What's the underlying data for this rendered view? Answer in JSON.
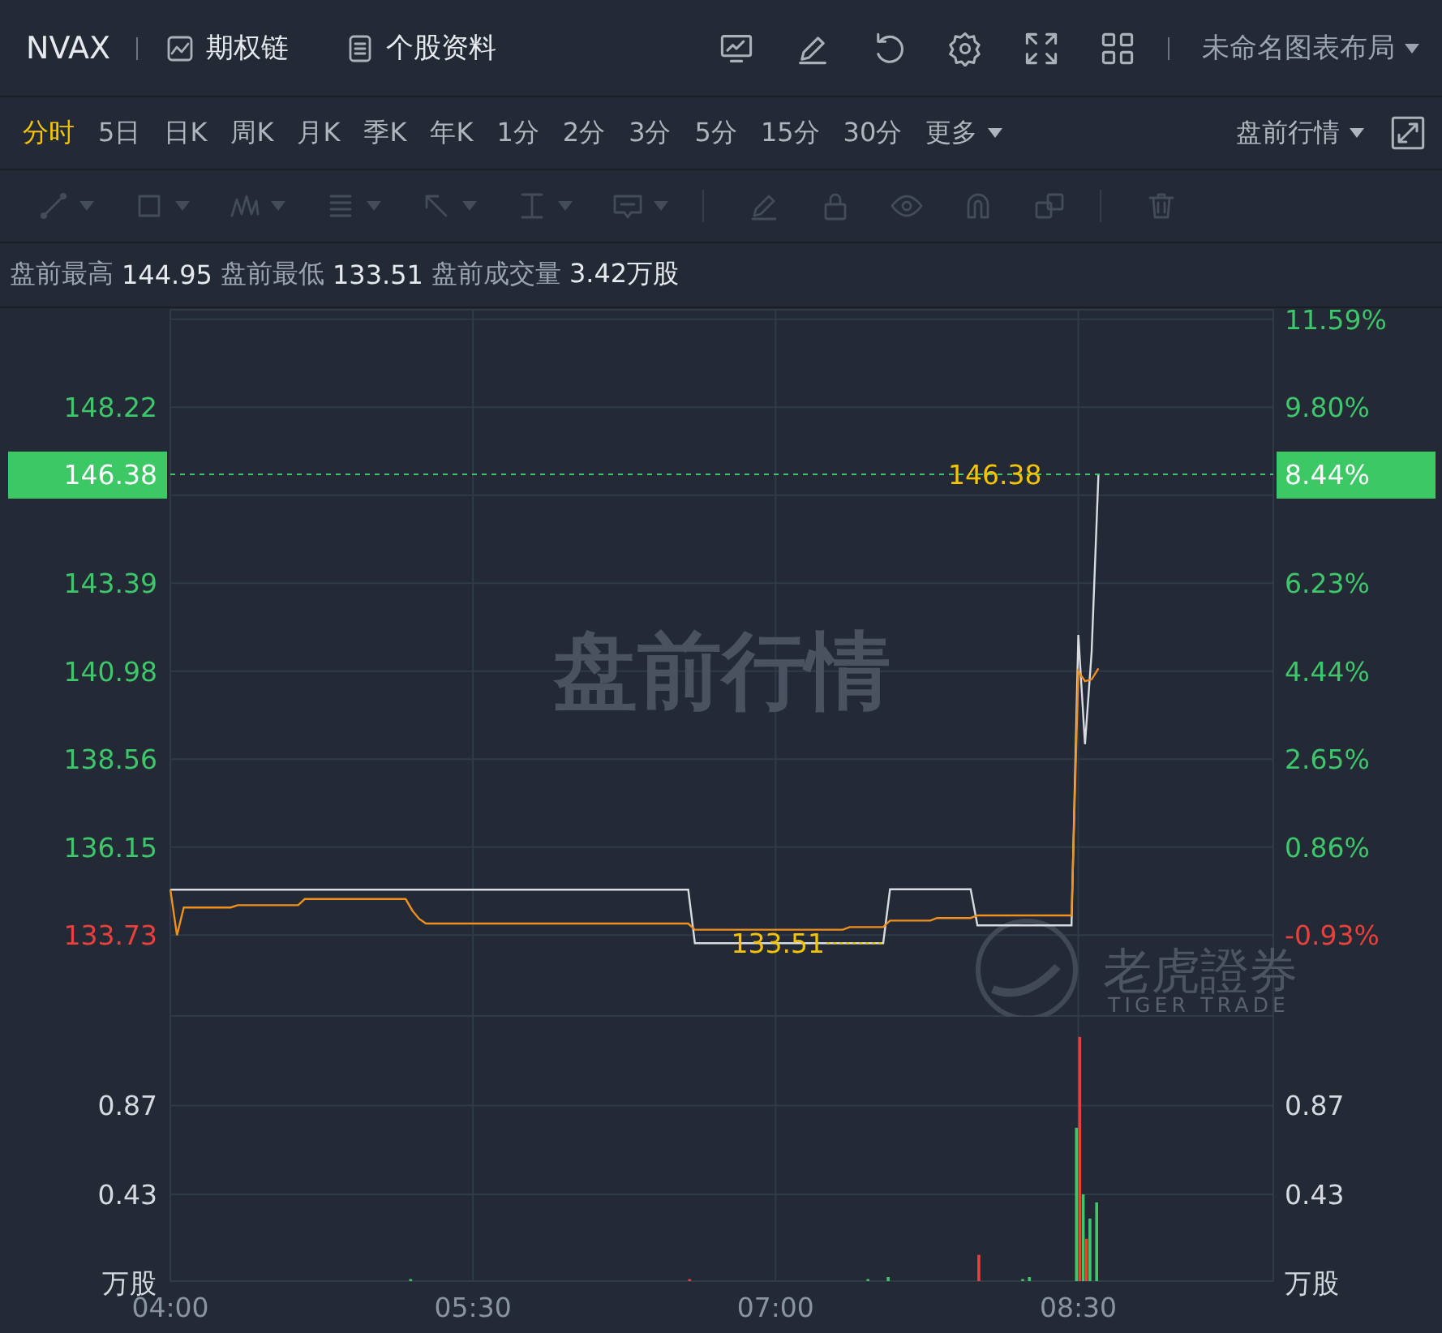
{
  "header": {
    "symbol": "NVAX",
    "links": [
      {
        "kind": "chain",
        "label": "期权链"
      },
      {
        "kind": "profile",
        "label": "个股资料"
      }
    ],
    "layout_menu": "未命名图表布局"
  },
  "periods": [
    {
      "label": "分时",
      "selected": true
    },
    {
      "label": "5日",
      "selected": false
    },
    {
      "label": "日K",
      "selected": false
    },
    {
      "label": "周K",
      "selected": false
    },
    {
      "label": "月K",
      "selected": false
    },
    {
      "label": "季K",
      "selected": false
    },
    {
      "label": "年K",
      "selected": false
    },
    {
      "label": "1分",
      "selected": false
    },
    {
      "label": "2分",
      "selected": false
    },
    {
      "label": "3分",
      "selected": false
    },
    {
      "label": "5分",
      "selected": false
    },
    {
      "label": "15分",
      "selected": false
    },
    {
      "label": "30分",
      "selected": false
    }
  ],
  "more_menu": "更多",
  "session_menu": "盘前行情",
  "draw_tools": [
    {
      "kind": "line",
      "menu": true,
      "disabled": true
    },
    {
      "kind": "rect",
      "menu": true,
      "disabled": true
    },
    {
      "kind": "pattern",
      "menu": true,
      "disabled": true
    },
    {
      "kind": "fib",
      "menu": true,
      "disabled": true
    },
    {
      "kind": "arrow",
      "menu": true,
      "disabled": true
    },
    {
      "kind": "measure",
      "menu": true,
      "disabled": true
    },
    {
      "kind": "note",
      "menu": true,
      "disabled": true
    },
    {
      "kind": "pen",
      "menu": false,
      "disabled": true
    },
    {
      "kind": "lock",
      "menu": false,
      "disabled": true
    },
    {
      "kind": "eye",
      "menu": false,
      "disabled": true
    },
    {
      "kind": "magnet",
      "menu": false,
      "disabled": true
    },
    {
      "kind": "copy",
      "menu": false,
      "disabled": true
    },
    {
      "kind": "trash",
      "menu": false,
      "disabled": true
    }
  ],
  "stats": [
    {
      "label": "盘前最高",
      "value": "144.95"
    },
    {
      "label": "盘前最低",
      "value": "133.51"
    },
    {
      "label": "盘前成交量",
      "value": "3.42万股"
    }
  ],
  "watermarks": {
    "center": "盘前行情",
    "brand": "老虎證券",
    "brand_sub": "TIGER TRADE"
  },
  "price_chart": {
    "last_change": "8.44%",
    "percent_scale": [
      {
        "label": "11.59%",
        "color": "#3ec66a"
      },
      {
        "label": "9.80%",
        "color": "#3ec66a"
      },
      {
        "label": "6.23%",
        "color": "#3ec66a"
      },
      {
        "label": "4.44%",
        "color": "#3ec66a"
      },
      {
        "label": "2.65%",
        "color": "#3ec66a"
      },
      {
        "label": "0.86%",
        "color": "#3ec66a"
      },
      {
        "label": "-0.93%",
        "color": "#e8413c"
      }
    ],
    "chart_data": {
      "type": "line",
      "grid": true,
      "categories": [
        null,
        null,
        null,
        null,
        null,
        null,
        null,
        null,
        null,
        null,
        null,
        null,
        null,
        null,
        null,
        null,
        null,
        null,
        null,
        null,
        null,
        null,
        null,
        null,
        null,
        null,
        null,
        null,
        null,
        null,
        null,
        null,
        null,
        null,
        null,
        null,
        null,
        null,
        null,
        null,
        null,
        null,
        null,
        null,
        null,
        null,
        null,
        null,
        null,
        null,
        null,
        null,
        null,
        null,
        null,
        null,
        null,
        null,
        null,
        null,
        null,
        null,
        null,
        null,
        null,
        null,
        null,
        null,
        null,
        null,
        null,
        null,
        null,
        null,
        null,
        null,
        null,
        null,
        null,
        null,
        null,
        null,
        null,
        null,
        null,
        null,
        null,
        null,
        null,
        null,
        null,
        null,
        null,
        null,
        null,
        null,
        null,
        null,
        null,
        null,
        null,
        null,
        null,
        null,
        null,
        null,
        null,
        null,
        null,
        null,
        null,
        null,
        null,
        null,
        null,
        null,
        null,
        null,
        null,
        null,
        null,
        null,
        null,
        null,
        null,
        null,
        null,
        null,
        null,
        null,
        null,
        null,
        null,
        null,
        null,
        null,
        null,
        null,
        null,
        null,
        null,
        null,
        null,
        null,
        null,
        null,
        null,
        null,
        null,
        null,
        null,
        null,
        null,
        null,
        null,
        null,
        null,
        null,
        null,
        null,
        null,
        null,
        null,
        null,
        null
      ],
      "series": [
        {
          "color": "#d8dce2",
          "values": [
            134.98,
            134.98,
            134.98,
            134.98,
            134.98,
            134.98,
            134.98,
            134.98,
            134.98,
            134.98,
            134.98,
            134.98,
            134.98,
            134.98,
            134.98,
            134.98,
            134.98,
            134.98,
            134.98,
            134.98,
            134.98,
            134.98,
            134.98,
            134.98,
            134.98,
            134.98,
            134.98,
            134.98,
            134.98,
            134.98,
            134.98,
            134.98,
            134.98,
            134.98,
            134.98,
            134.98,
            134.98,
            134.98,
            134.98,
            134.98,
            134.98,
            134.98,
            134.98,
            134.98,
            134.98,
            134.98,
            134.98,
            134.98,
            134.98,
            134.98,
            134.98,
            134.98,
            134.98,
            134.98,
            134.98,
            134.98,
            134.98,
            134.98,
            134.98,
            134.98,
            134.98,
            134.98,
            134.98,
            134.98,
            134.98,
            134.98,
            134.98,
            134.98,
            134.98,
            134.98,
            134.98,
            134.98,
            134.98,
            134.98,
            134.98,
            134.98,
            134.98,
            134.98,
            133.51,
            133.51,
            133.51,
            133.51,
            133.51,
            133.51,
            133.51,
            133.51,
            133.51,
            133.51,
            133.51,
            133.51,
            133.51,
            133.51,
            133.51,
            133.51,
            133.51,
            133.51,
            133.51,
            133.51,
            133.51,
            133.51,
            133.51,
            133.51,
            133.51,
            133.51,
            133.51,
            133.51,
            133.51,
            134.99,
            134.99,
            134.99,
            134.99,
            134.99,
            134.99,
            134.99,
            134.99,
            134.99,
            134.99,
            134.99,
            134.99,
            134.99,
            134,
            134,
            134,
            134,
            134,
            134,
            134,
            134,
            134,
            134,
            134,
            134,
            134,
            134,
            134,
            141.97,
            138.97,
            141.5,
            146.38,
            null,
            null,
            null,
            null,
            null,
            null,
            null,
            null,
            null,
            null,
            null,
            null,
            null,
            null,
            null,
            null,
            null,
            null,
            null,
            null,
            null,
            null,
            null,
            null,
            null,
            null
          ]
        },
        {
          "color": "#f0901e",
          "values": [
            134.99,
            133.73,
            134.49,
            134.49,
            134.49,
            134.49,
            134.49,
            134.49,
            134.49,
            134.49,
            134.55,
            134.55,
            134.55,
            134.55,
            134.55,
            134.55,
            134.55,
            134.55,
            134.55,
            134.55,
            134.72,
            134.72,
            134.72,
            134.72,
            134.72,
            134.72,
            134.72,
            134.72,
            134.72,
            134.72,
            134.72,
            134.72,
            134.72,
            134.72,
            134.72,
            134.72,
            134.4,
            134.18,
            134.05,
            134.05,
            134.05,
            134.05,
            134.05,
            134.05,
            134.05,
            134.05,
            134.05,
            134.05,
            134.05,
            134.05,
            134.05,
            134.05,
            134.05,
            134.05,
            134.05,
            134.05,
            134.05,
            134.05,
            134.05,
            134.05,
            134.05,
            134.05,
            134.05,
            134.05,
            134.05,
            134.05,
            134.05,
            134.05,
            134.05,
            134.05,
            134.05,
            134.05,
            134.05,
            134.05,
            134.05,
            134.05,
            134.05,
            134.05,
            133.88,
            133.88,
            133.88,
            133.88,
            133.88,
            133.88,
            133.88,
            133.88,
            133.88,
            133.88,
            133.88,
            133.88,
            133.88,
            133.88,
            133.88,
            133.88,
            133.88,
            133.88,
            133.88,
            133.88,
            133.88,
            133.88,
            133.88,
            133.95,
            133.95,
            133.95,
            133.95,
            133.95,
            133.95,
            134.13,
            134.13,
            134.13,
            134.13,
            134.13,
            134.13,
            134.13,
            134.2,
            134.2,
            134.2,
            134.2,
            134.2,
            134.2,
            134.27,
            134.27,
            134.27,
            134.27,
            134.27,
            134.27,
            134.27,
            134.27,
            134.27,
            134.27,
            134.27,
            134.27,
            134.27,
            134.27,
            134.27,
            140.97,
            140.7,
            140.75,
            141.05,
            null,
            null,
            null,
            null,
            null,
            null,
            null,
            null,
            null,
            null,
            null,
            null,
            null,
            null,
            null,
            null,
            null,
            null,
            null,
            null,
            null,
            null,
            null,
            null,
            null,
            null
          ]
        }
      ],
      "ylim": [
        131.49,
        150.94
      ],
      "yticks": [
        {
          "value": 148.22,
          "label": "148.22"
        },
        {
          "value": 143.39,
          "label": "143.39"
        },
        {
          "value": 140.98,
          "label": "140.98"
        },
        {
          "value": 138.56,
          "label": "138.56"
        },
        {
          "value": 136.15,
          "label": "136.15"
        },
        {
          "value": 133.73,
          "label": "133.73"
        }
      ],
      "ref_lines": [
        {
          "axis": "y",
          "value": 146.38,
          "label": "146.38",
          "color": "#3ec66a"
        }
      ],
      "annotations": [
        "146.38",
        "133.51"
      ]
    }
  },
  "volume_chart": {
    "right_unit": "万股",
    "right_ticks": [
      "0.87",
      "0.43"
    ],
    "chart_data": {
      "type": "bar",
      "grid": true,
      "categories": [
        "04:00",
        null,
        null,
        null,
        null,
        null,
        null,
        null,
        null,
        null,
        null,
        null,
        null,
        null,
        null,
        null,
        null,
        null,
        null,
        null,
        null,
        null,
        null,
        null,
        null,
        null,
        null,
        null,
        null,
        null,
        null,
        null,
        null,
        null,
        null,
        null,
        null,
        null,
        null,
        null,
        null,
        null,
        null,
        null,
        null,
        "05:30",
        null,
        null,
        null,
        null,
        null,
        null,
        null,
        null,
        null,
        null,
        null,
        null,
        null,
        null,
        null,
        null,
        null,
        null,
        null,
        null,
        null,
        null,
        null,
        null,
        null,
        null,
        null,
        null,
        null,
        null,
        null,
        null,
        null,
        null,
        null,
        null,
        null,
        null,
        null,
        null,
        null,
        null,
        null,
        null,
        "07:00",
        null,
        null,
        null,
        null,
        null,
        null,
        null,
        null,
        null,
        null,
        null,
        null,
        null,
        null,
        null,
        null,
        null,
        null,
        null,
        null,
        null,
        null,
        null,
        null,
        null,
        null,
        null,
        null,
        null,
        null,
        null,
        null,
        null,
        null,
        null,
        null,
        null,
        null,
        null,
        null,
        null,
        null,
        null,
        null,
        "08:30",
        null,
        null,
        null,
        null,
        null,
        null,
        null,
        null,
        null,
        null,
        null,
        null,
        null,
        null,
        null,
        null,
        null,
        null,
        null,
        null,
        null,
        null,
        null,
        null,
        null,
        null,
        null,
        null,
        null
      ],
      "series": [
        {
          "color": "#3ec66a",
          "values": [
            null,
            null,
            null,
            null,
            null,
            null,
            null,
            null,
            null,
            null,
            null,
            null,
            null,
            null,
            null,
            null,
            null,
            null,
            null,
            null,
            null,
            null,
            null,
            null,
            null,
            null,
            null,
            null,
            null,
            null,
            null,
            null,
            null,
            null,
            null,
            null,
            0.01,
            null,
            null,
            null,
            null,
            null,
            null,
            null,
            null,
            null,
            null,
            null,
            null,
            null,
            null,
            null,
            null,
            null,
            null,
            null,
            null,
            null,
            null,
            null,
            null,
            null,
            null,
            null,
            null,
            null,
            null,
            null,
            null,
            null,
            null,
            null,
            null,
            null,
            null,
            null,
            null,
            null,
            null,
            null,
            null,
            null,
            null,
            null,
            null,
            null,
            null,
            null,
            null,
            null,
            null,
            null,
            null,
            null,
            null,
            null,
            null,
            null,
            null,
            null,
            null,
            null,
            null,
            null,
            0.01,
            null,
            null,
            0.02,
            null,
            null,
            null,
            null,
            null,
            null,
            null,
            null,
            null,
            null,
            null,
            null,
            null,
            null,
            null,
            null,
            null,
            null,
            null,
            0.01,
            0.02,
            null,
            null,
            null,
            null,
            null,
            null,
            0.76,
            0.43,
            0.31,
            0.39,
            null,
            null,
            null,
            null,
            null,
            null,
            null,
            null,
            null,
            null,
            null,
            null,
            null,
            null,
            null,
            null,
            null,
            null,
            null,
            null,
            null,
            null,
            null,
            null,
            null,
            null
          ]
        },
        {
          "color": "#e8413c",
          "values": [
            null,
            null,
            null,
            null,
            null,
            null,
            null,
            null,
            null,
            null,
            null,
            null,
            null,
            null,
            null,
            null,
            null,
            null,
            null,
            null,
            null,
            null,
            null,
            null,
            null,
            null,
            null,
            null,
            null,
            null,
            null,
            null,
            null,
            null,
            null,
            null,
            null,
            null,
            null,
            null,
            null,
            null,
            null,
            null,
            null,
            null,
            null,
            null,
            null,
            null,
            null,
            null,
            null,
            null,
            null,
            null,
            null,
            null,
            null,
            null,
            null,
            null,
            null,
            null,
            null,
            null,
            null,
            null,
            null,
            null,
            null,
            null,
            null,
            null,
            null,
            null,
            null,
            0.01,
            null,
            null,
            null,
            null,
            null,
            null,
            null,
            null,
            null,
            null,
            null,
            null,
            null,
            null,
            null,
            null,
            null,
            null,
            null,
            null,
            null,
            null,
            null,
            null,
            null,
            null,
            null,
            null,
            null,
            null,
            null,
            null,
            null,
            null,
            null,
            null,
            null,
            null,
            null,
            null,
            null,
            null,
            0.13,
            null,
            null,
            null,
            null,
            null,
            null,
            null,
            null,
            null,
            null,
            null,
            null,
            null,
            null,
            1.21,
            0.21,
            null,
            null,
            null,
            null,
            null,
            null,
            null,
            null,
            null,
            null,
            null,
            null,
            null,
            null,
            null,
            null,
            null,
            null,
            null,
            null,
            null,
            null,
            null,
            null,
            null,
            null,
            null,
            null
          ]
        }
      ],
      "ylim": [
        0,
        1.31
      ],
      "ylabel": "万股",
      "yticks": [
        {
          "value": 0.87,
          "label": "0.87"
        },
        {
          "value": 0.43,
          "label": "0.43"
        }
      ]
    }
  }
}
